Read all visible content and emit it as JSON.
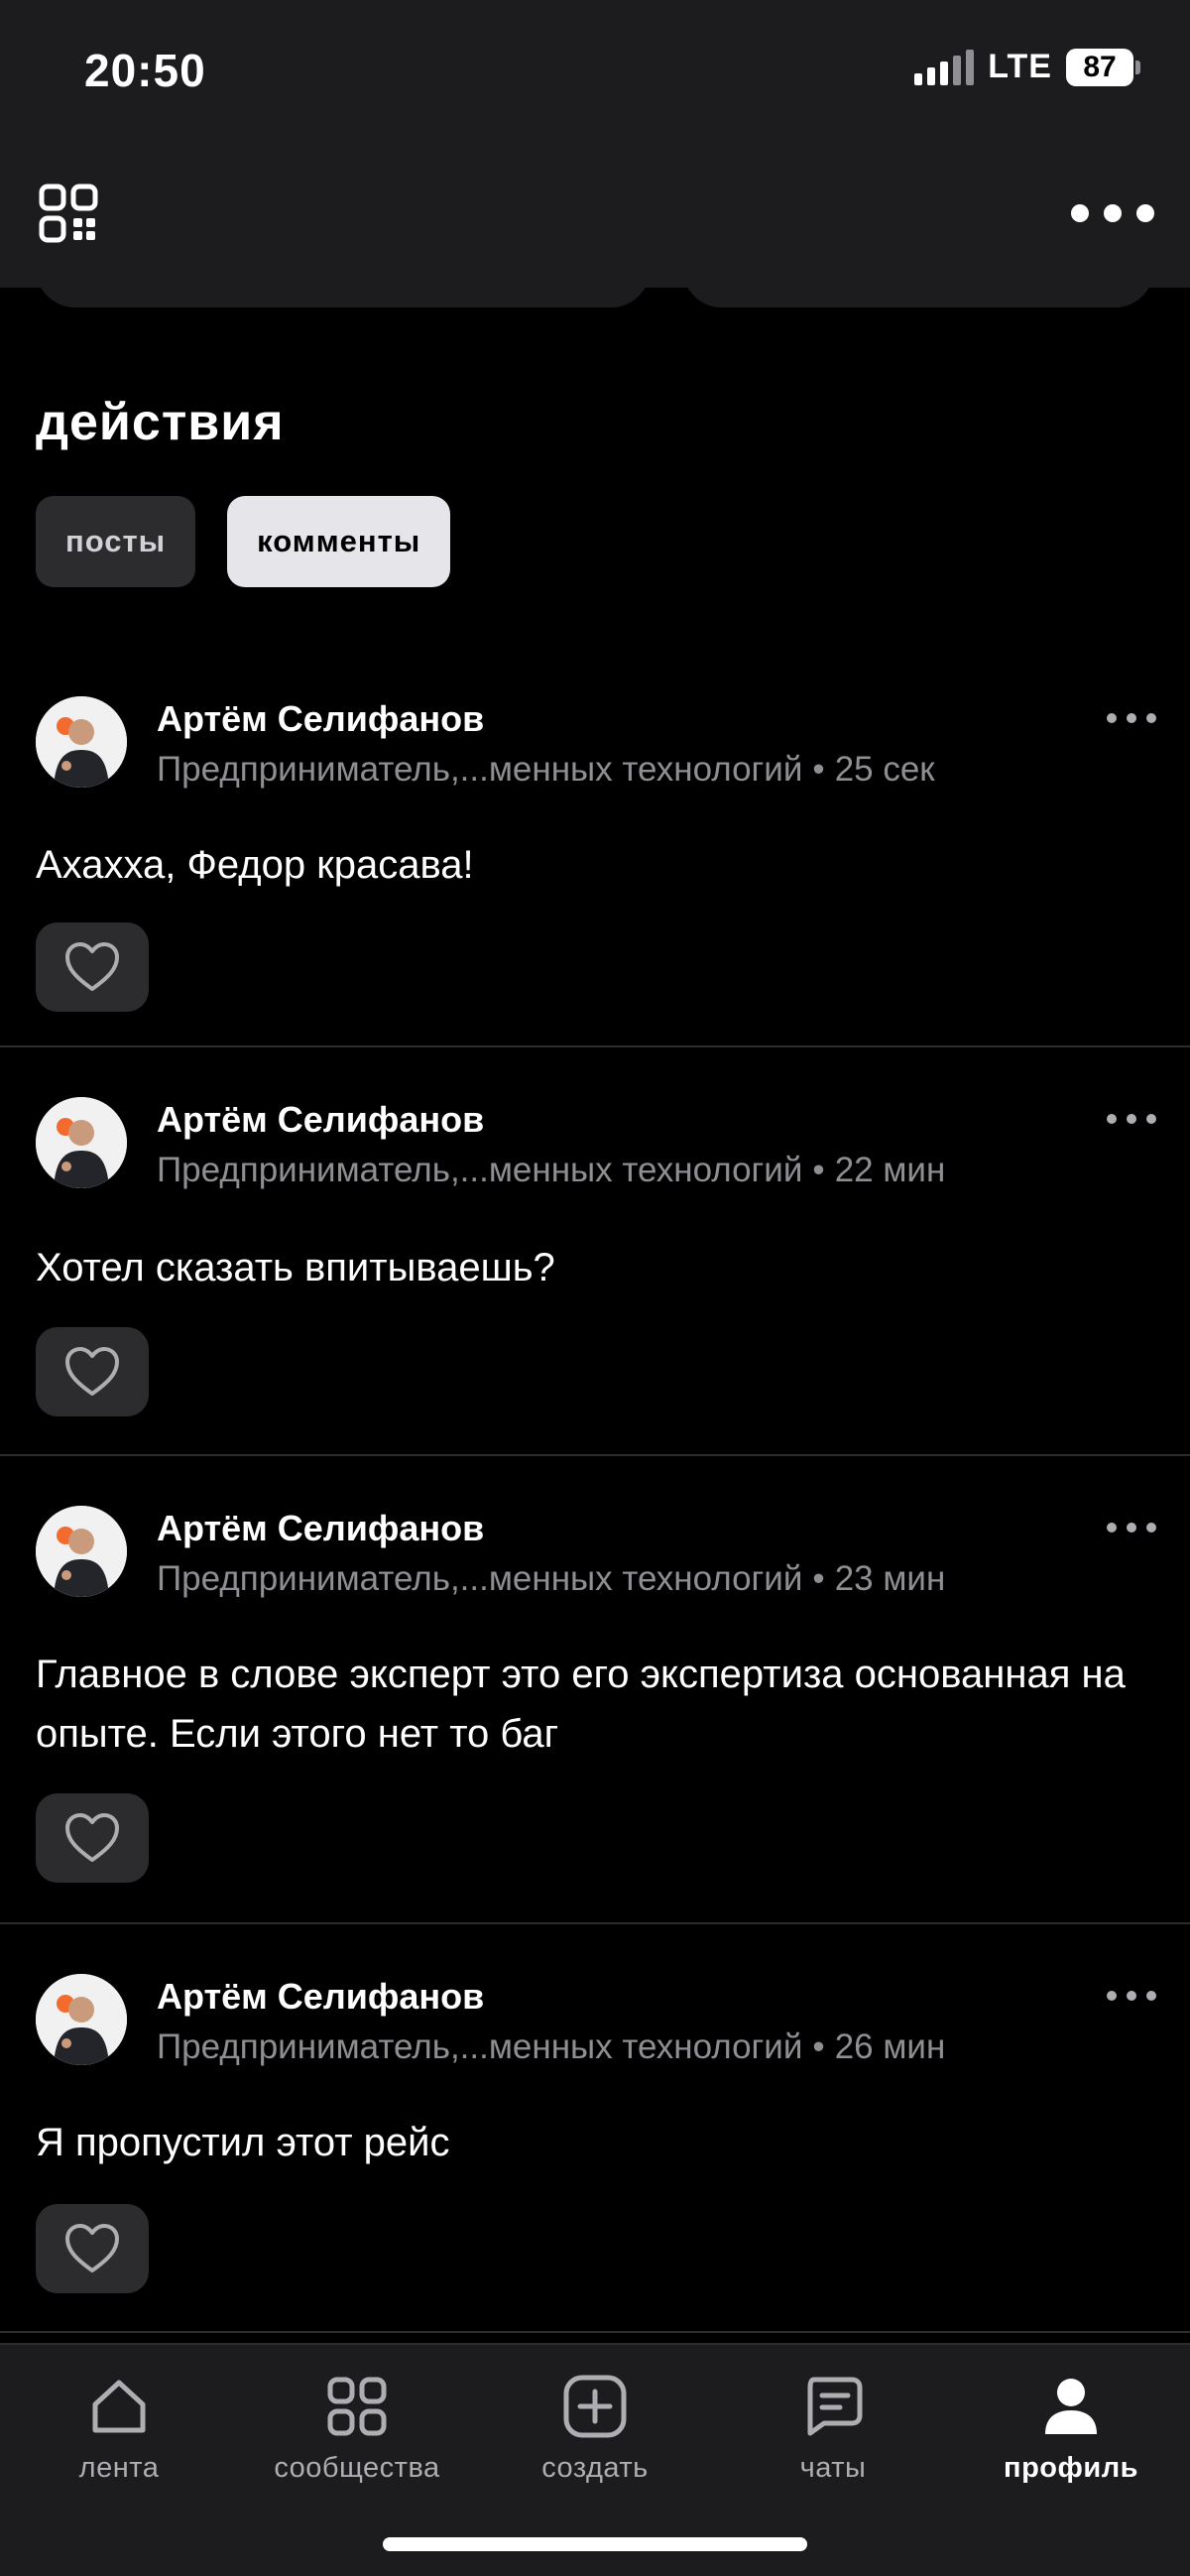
{
  "status_bar": {
    "time": "20:50",
    "network": "LTE",
    "battery": "87"
  },
  "header": {
    "qr_icon": "qr-code-icon",
    "more_icon": "more-horizontal-icon"
  },
  "section": {
    "title": "действия"
  },
  "tabs": [
    {
      "label": "посты",
      "active": false
    },
    {
      "label": "комменты",
      "active": true
    }
  ],
  "comments": [
    {
      "author": "Артём Селифанов",
      "subtitle": "Предприниматель,...менных технологий",
      "time": "25 сек",
      "text": "Ахахха, Федор красава!"
    },
    {
      "author": "Артём Селифанов",
      "subtitle": "Предприниматель,...менных технологий",
      "time": "22 мин",
      "text": "Хотел сказать впитываешь?"
    },
    {
      "author": "Артём Селифанов",
      "subtitle": "Предприниматель,...менных технологий",
      "time": "23 мин",
      "text": "Главное в слове эксперт это его экспертиза основанная на опыте. Если этого нет то баг"
    },
    {
      "author": "Артём Селифанов",
      "subtitle": "Предприниматель,...менных технологий",
      "time": "26 мин",
      "text": "Я пропустил этот рейс"
    }
  ],
  "bottom_nav": [
    {
      "label": "лента",
      "icon": "home-icon",
      "active": false
    },
    {
      "label": "сообщества",
      "icon": "grid-icon",
      "active": false
    },
    {
      "label": "создать",
      "icon": "plus-square-icon",
      "active": false
    },
    {
      "label": "чаты",
      "icon": "chat-icon",
      "active": false
    },
    {
      "label": "профиль",
      "icon": "profile-icon",
      "active": true
    }
  ],
  "colors": {
    "background": "#000000",
    "surface": "#1c1c1e",
    "chip": "#2c2c2e",
    "muted_text": "#8e8e93"
  }
}
